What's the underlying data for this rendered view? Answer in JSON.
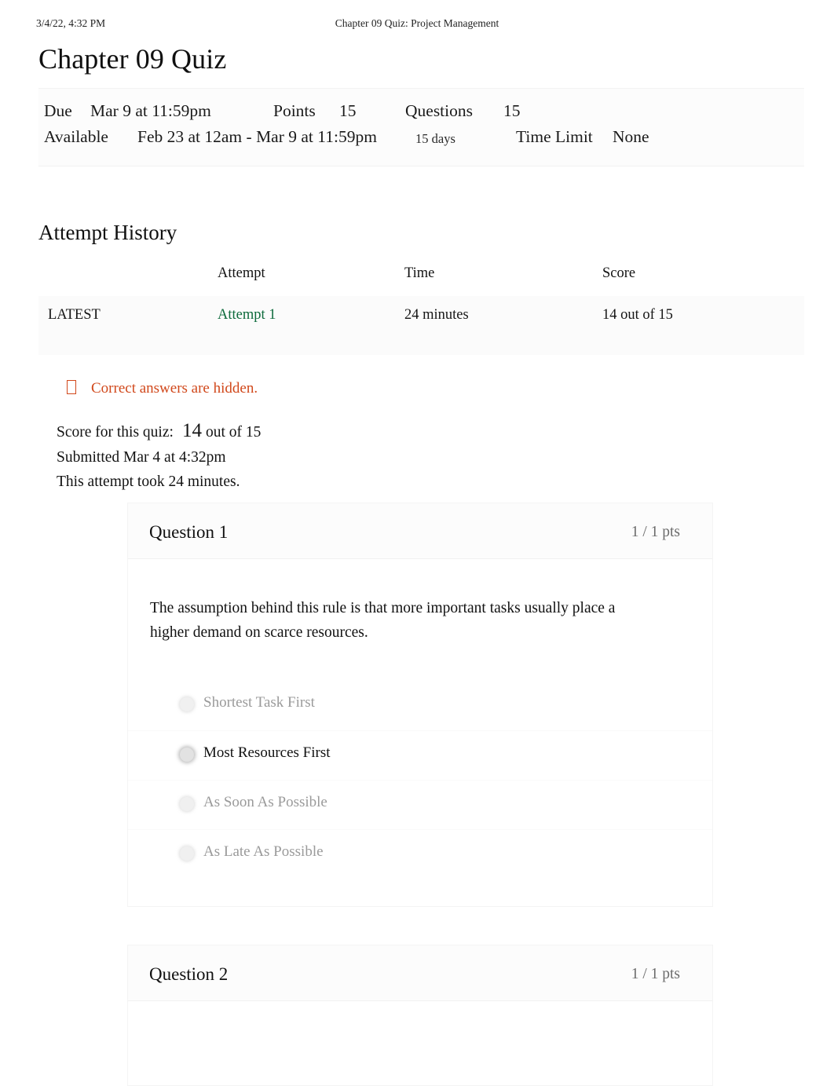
{
  "print_header": {
    "date": "3/4/22, 4:32 PM",
    "title": "Chapter 09 Quiz: Project Management"
  },
  "page_title": "Chapter 09 Quiz",
  "quiz_header": {
    "due_label": "Due",
    "due_value": "Mar 9 at 11:59pm",
    "points_label": "Points",
    "points_value": "15",
    "questions_label": "Questions",
    "questions_value": "15",
    "available_label": "Available",
    "available_value": "Feb 23 at 12am - Mar 9 at 11:59pm",
    "available_days": "15 days",
    "time_limit_label": "Time Limit",
    "time_limit_value": "None"
  },
  "attempt_history": {
    "heading": "Attempt History",
    "columns": [
      "",
      "Attempt",
      "Time",
      "Score"
    ],
    "rows": [
      {
        "kept": "LATEST",
        "attempt": "Attempt 1",
        "time": "24 minutes",
        "score": "14 out of 15"
      }
    ]
  },
  "hidden_notice": {
    "icon": "warning-icon",
    "text": "Correct answers are hidden."
  },
  "score_summary": {
    "score_label": "Score for this quiz:",
    "score_value": "14",
    "score_out_of": "out of 15",
    "submitted": "Submitted Mar 4 at 4:32pm",
    "duration": "This attempt took 24 minutes."
  },
  "questions": [
    {
      "name": "Question 1",
      "points": "1 / 1 pts",
      "text": "The assumption behind this rule is that more important tasks usually place a higher demand on scarce resources.",
      "answers": [
        {
          "label": "Shortest Task First",
          "selected": false
        },
        {
          "label": "Most Resources First",
          "selected": true
        },
        {
          "label": "As Soon As Possible",
          "selected": false
        },
        {
          "label": "As Late As Possible",
          "selected": false
        }
      ]
    },
    {
      "name": "Question 2",
      "points": "1 / 1 pts",
      "text": "",
      "answers": []
    }
  ],
  "colors": {
    "link_green": "#0e6b3c",
    "notice_orange": "#d1481b",
    "points_grey": "#6c6c6c",
    "text": "#111111"
  }
}
